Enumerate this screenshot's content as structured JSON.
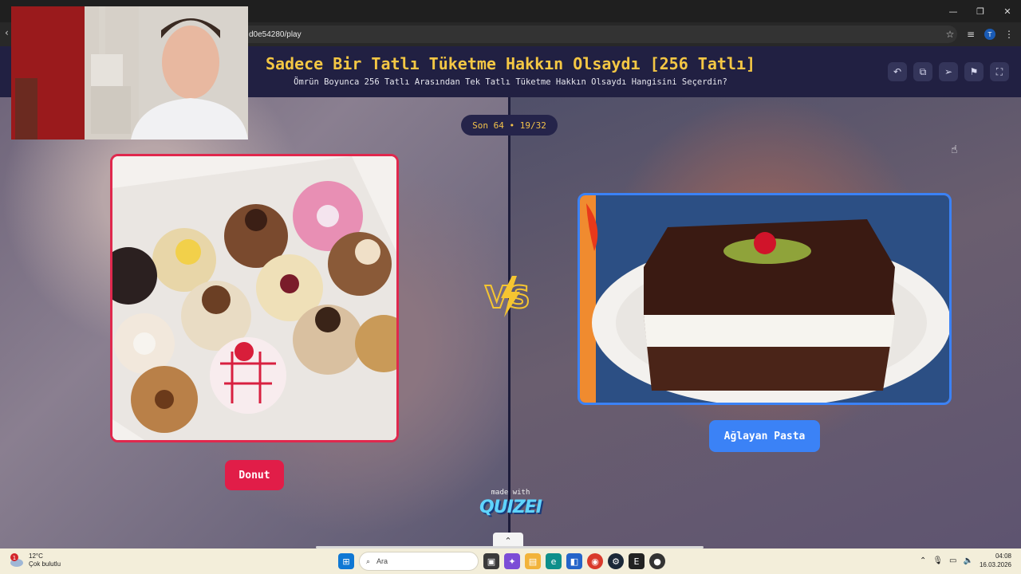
{
  "browser": {
    "url": "d0e54280/play",
    "profile_initial": "T"
  },
  "header": {
    "title": "Sadece Bir Tatlı Tüketme Hakkın Olsaydı [256 Tatlı]",
    "subtitle": "Ömrün Boyunca 256 Tatlı Arasından Tek Tatlı Tüketme Hakkın Olsaydı Hangisini Seçerdin?",
    "tools": [
      "undo-icon",
      "share-icon",
      "send-icon",
      "flag-icon",
      "fullscreen-icon"
    ]
  },
  "round": {
    "label": "Son 64 • 19/32"
  },
  "left_choice": {
    "name": "Donut",
    "accent": "#e11d48"
  },
  "right_choice": {
    "name": "Ağlayan Pasta",
    "accent": "#3b82f6"
  },
  "vs_label": "VS",
  "footer": {
    "made_with": "made with",
    "brand": "QUIZEI"
  },
  "taskbar": {
    "weather_temp": "12°C",
    "weather_desc": "Çok bulutlu",
    "weather_badge": "1",
    "search_placeholder": "Ara",
    "time": "04:08",
    "date": "16.03.2026"
  }
}
